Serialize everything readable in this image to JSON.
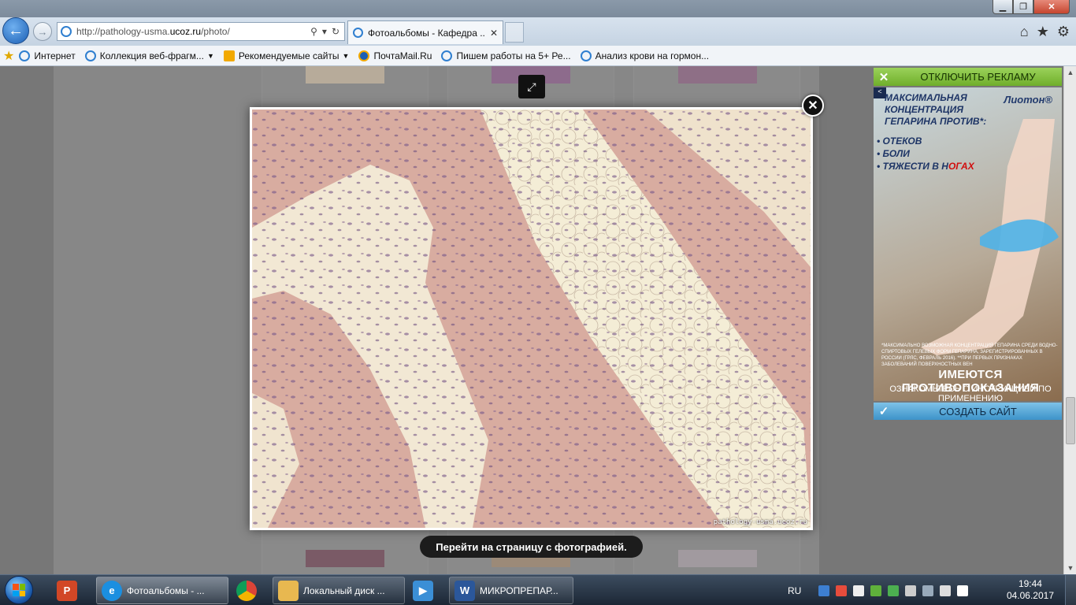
{
  "browser": {
    "window_controls": {
      "minimize": "▁",
      "maximize": "❐",
      "close": "✕"
    },
    "address": {
      "url_prefix": "http://pathology-usma.",
      "url_host": "ucoz.ru",
      "url_suffix": "/photo/"
    },
    "tab": {
      "label": "Фотоальбомы - Кафедра ...",
      "close": "✕"
    },
    "nav_icons": [
      "home-icon",
      "favorites-star-icon",
      "tools-gear-icon"
    ],
    "favorites_bar": [
      {
        "label": "Интернет",
        "has_dropdown": false,
        "icon": "ie-page-icon"
      },
      {
        "label": "Коллекция веб-фрагм...",
        "has_dropdown": true,
        "icon": "ie-page-icon"
      },
      {
        "label": "Рекомендуемые сайты",
        "has_dropdown": true,
        "icon": "bing-icon"
      },
      {
        "label": "ПочтаMail.Ru",
        "has_dropdown": false,
        "icon": "mailru-icon"
      },
      {
        "label": "Пишем работы на 5+  Ре...",
        "has_dropdown": false,
        "icon": "ie-page-icon"
      },
      {
        "label": "Анализ крови на гормон...",
        "has_dropdown": false,
        "icon": "ie-page-icon"
      }
    ]
  },
  "lightbox": {
    "watermark": "pathology-usma.ucoz.ru",
    "expand_icon": "⤢",
    "close_icon": "✕",
    "go_to_page": "Перейти на страницу с фотографией."
  },
  "ad": {
    "disable_label": "ОТКЛЮЧИТЬ РЕКЛАМУ",
    "brand": "Лиотон®",
    "headline": "МАКСИМАЛЬНАЯ КОНЦЕНТРАЦИЯ ГЕПАРИНА ПРОТИВ*:",
    "bullets": [
      "ОТЕКОВ",
      "БОЛИ"
    ],
    "bullet_last_prefix": "ТЯЖЕСТИ В Н",
    "bullet_last_highlight": "ОГАХ",
    "fine_print": "*МАКСИМАЛЬНО ВОЗМОЖНАЯ КОНЦЕНТРАЦИЯ ГЕПАРИНА СРЕДИ ВОДНО-СПИРТОВЫХ ГЕЛЕВЫХ ФОРМ ГЕПАРИНА, ЗАРЕГИСТРИРОВАННЫХ В РОССИИ (ГРЛС, ФЕВРАЛЬ 2016). **ПРИ ПЕРВЫХ ПРИЗНАКАХ ЗАБОЛЕВАНИЙ ПОВЕРХНОСТНЫХ ВЕН",
    "contraindications": "ИМЕЮТСЯ ПРОТИВОПОКАЗАНИЯ",
    "instructions": "ОЗНАКОМЬТЕСЬ С ИНСТРУКЦИЕЙ ПО ПРИМЕНЕНИЮ",
    "create_site": "СОЗДАТЬ САЙТ"
  },
  "taskbar": {
    "items": [
      {
        "label": "",
        "icon": "powerpoint-icon"
      },
      {
        "label": "Фотоальбомы - ...",
        "icon": "internet-explorer-icon"
      },
      {
        "label": "",
        "icon": "chrome-icon"
      },
      {
        "label": "Локальный диск ...",
        "icon": "explorer-folder-icon"
      },
      {
        "label": "",
        "icon": "media-player-icon"
      },
      {
        "label": "МИКРОПРЕПАР...",
        "icon": "word-icon"
      }
    ],
    "language": "RU",
    "time": "19:44",
    "date": "04.06.2017"
  },
  "colors": {
    "ie_blue": "#1b5fb4",
    "ad_green": "#6fae2b",
    "ad_blue": "#3d93c9",
    "tissue_pink": "#d8aca0",
    "fat_cream": "#f4edd6"
  }
}
